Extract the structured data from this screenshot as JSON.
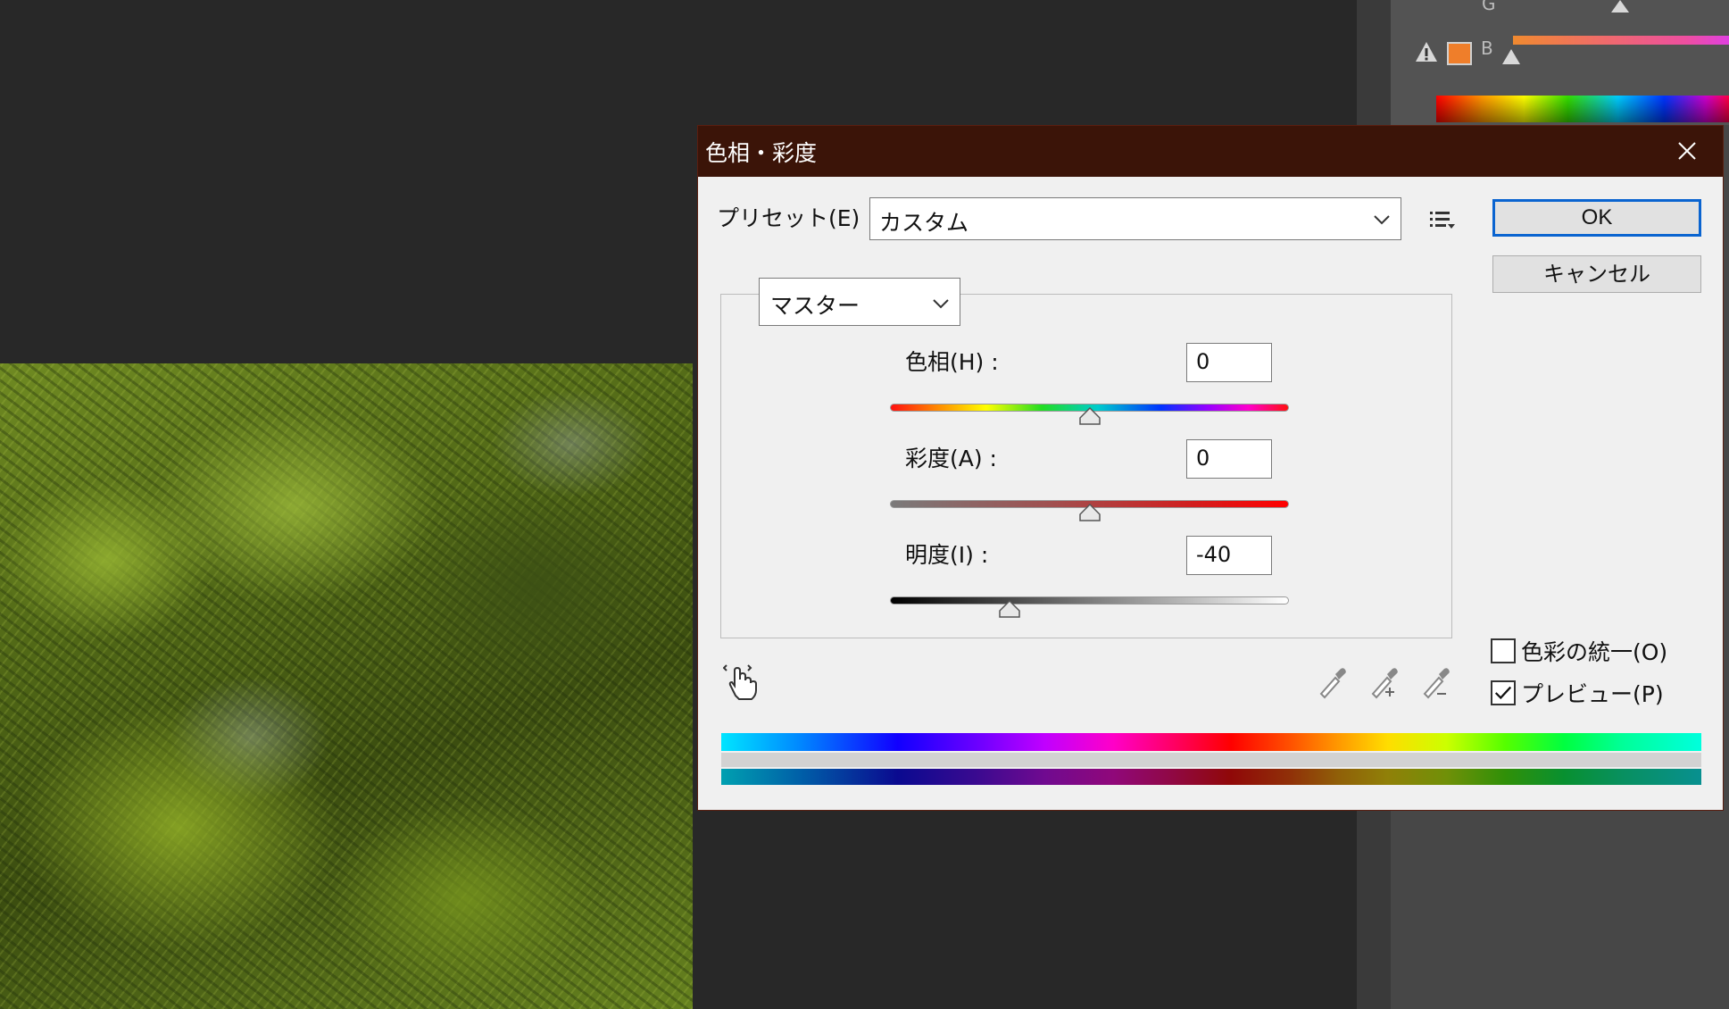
{
  "dialog": {
    "title": "色相・彩度",
    "preset_label": "プリセット(E) :",
    "preset_value": "カスタム",
    "ok_label": "OK",
    "cancel_label": "キャンセル",
    "channel_value": "マスター",
    "hue": {
      "label": "色相(H) :",
      "value": "0",
      "slider_fraction": 0.5
    },
    "saturation": {
      "label": "彩度(A) :",
      "value": "0",
      "slider_fraction": 0.5
    },
    "lightness": {
      "label": "明度(I) :",
      "value": "-40",
      "slider_fraction": 0.3
    },
    "colorize": {
      "label": "色彩の統一(O)",
      "checked": false
    },
    "preview": {
      "label": "プレビュー(P)",
      "checked": true
    }
  },
  "right_panel": {
    "g_channel_label": "G",
    "channel_label": "B",
    "swatch_color": "#ef7e2a"
  },
  "icons": {
    "close": "close-icon",
    "preset_options": "preset-options-icon",
    "targeted_adjustment": "hand-pointer-icon",
    "eyedropper": "eyedropper-icon",
    "eyedropper_plus": "eyedropper-plus-icon",
    "eyedropper_minus": "eyedropper-minus-icon",
    "gamut_warning": "warning-icon"
  },
  "colors": {
    "titlebar": "#3b1408",
    "ok_border": "#0a64d0"
  }
}
